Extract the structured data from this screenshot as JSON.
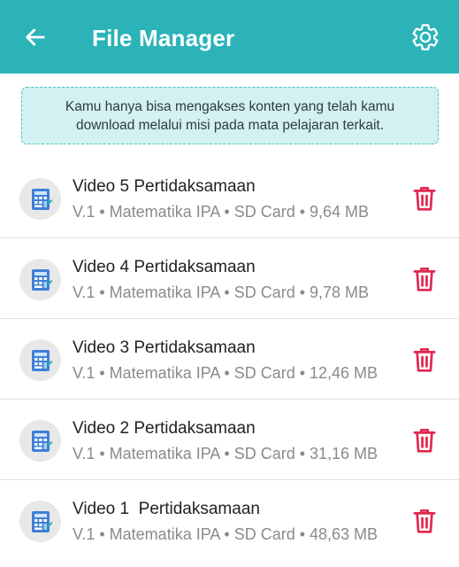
{
  "appbar": {
    "title": "File Manager",
    "back_icon": "arrow-left-icon",
    "settings_icon": "gear-icon",
    "background": "#2bb3b8"
  },
  "notice": {
    "text": "Kamu hanya bisa mengakses konten yang telah kamu download melalui misi pada mata pelajaran terkait."
  },
  "files": [
    {
      "name": "Video 5 Pertidaksamaan",
      "meta": "V.1 • Matematika IPA • SD Card • 9,64 MB"
    },
    {
      "name": "Video 4 Pertidaksamaan",
      "meta": "V.1 • Matematika IPA • SD Card • 9,78 MB"
    },
    {
      "name": "Video 3 Pertidaksamaan",
      "meta": "V.1 • Matematika IPA • SD Card • 12,46 MB"
    },
    {
      "name": "Video 2 Pertidaksamaan",
      "meta": "V.1 • Matematika IPA • SD Card • 31,16 MB"
    },
    {
      "name": "Video 1  Pertidaksamaan",
      "meta": "V.1 • Matematika IPA • SD Card • 48,63 MB"
    }
  ],
  "colors": {
    "accent": "#2bb3b8",
    "delete": "#e0284f",
    "notice_bg": "#d3f1f1"
  }
}
